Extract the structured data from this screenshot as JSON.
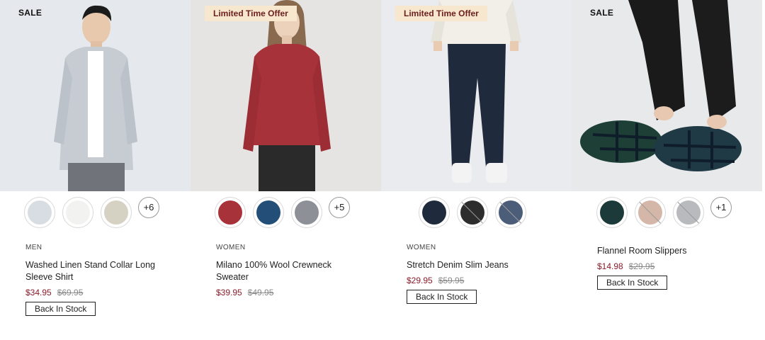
{
  "products": [
    {
      "badge": "SALE",
      "category": "MEN",
      "name": "Washed Linen Stand Collar Long Sleeve Shirt",
      "sale_price": "$34.95",
      "original_price": "$69.95",
      "stock_label": "Back In Stock",
      "more_colors": "+6"
    },
    {
      "badge": "Limited Time Offer",
      "category": "WOMEN",
      "name": "Milano 100% Wool Crewneck Sweater",
      "sale_price": "$39.95",
      "original_price": "$49.95",
      "more_colors": "+5"
    },
    {
      "badge": "Limited Time Offer",
      "category": "WOMEN",
      "name": "Stretch Denim Slim Jeans",
      "sale_price": "$29.95",
      "original_price": "$59.95",
      "stock_label": "Back In Stock"
    },
    {
      "badge": "SALE",
      "category": "",
      "name": "Flannel Room Slippers",
      "sale_price": "$14.98",
      "original_price": "$29.95",
      "stock_label": "Back In Stock",
      "more_colors": "+1"
    }
  ],
  "colors": {
    "sale_price": "#8a1c2b",
    "offer_badge_bg": "#f8e7cf",
    "offer_badge_text": "#6b1e1e"
  }
}
